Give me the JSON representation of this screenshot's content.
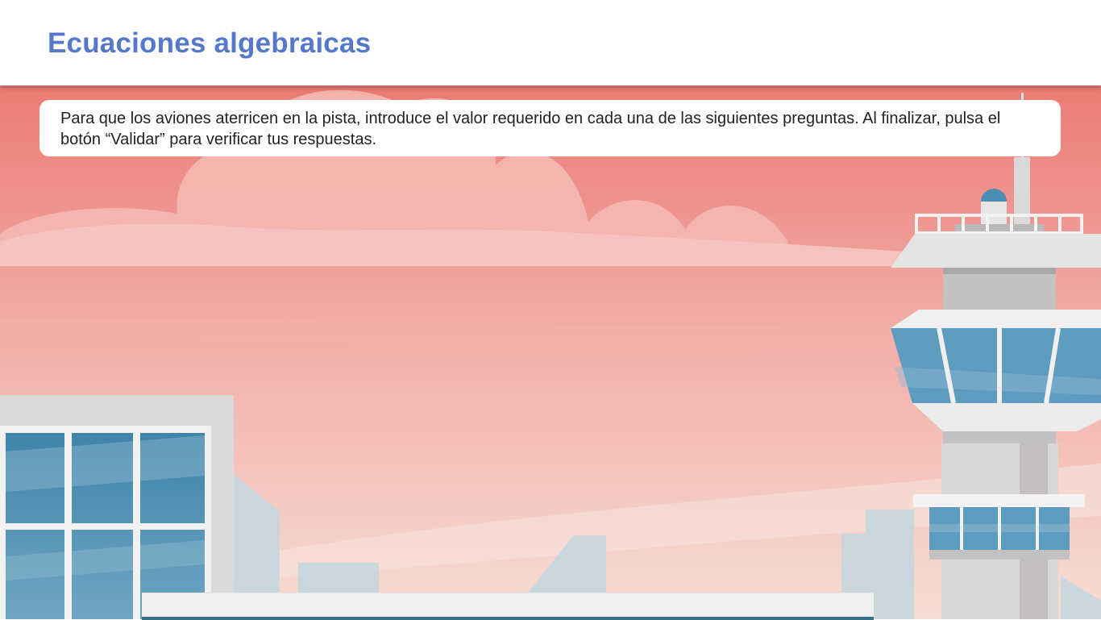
{
  "header": {
    "title": "Ecuaciones algebraicas"
  },
  "instructions": {
    "text": "Para que los aviones aterricen en la pista, introduce el valor requerido en cada una de las siguientes preguntas. Al finalizar, pulsa el botón “Validar” para verificar tus respuestas."
  },
  "colors": {
    "title": "#5578c9",
    "sky_top": "#ec7b73",
    "sky_bottom": "#f5dcd3",
    "glass": "#4c8fb2",
    "building": "#e1dfdf"
  }
}
